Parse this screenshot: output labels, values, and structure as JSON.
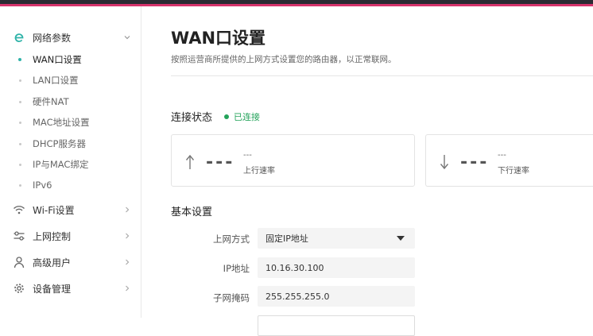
{
  "sidebar": {
    "groups": [
      {
        "label": "网络参数",
        "icon": "brand-e-icon"
      },
      {
        "label": "Wi-Fi设置",
        "icon": "wifi-icon"
      },
      {
        "label": "上网控制",
        "icon": "sliders-icon"
      },
      {
        "label": "高级用户",
        "icon": "user-icon"
      },
      {
        "label": "设备管理",
        "icon": "gear-icon"
      }
    ],
    "network_items": [
      {
        "label": "WAN口设置",
        "active": true
      },
      {
        "label": "LAN口设置"
      },
      {
        "label": "硬件NAT"
      },
      {
        "label": "MAC地址设置"
      },
      {
        "label": "DHCP服务器"
      },
      {
        "label": "IP与MAC绑定"
      },
      {
        "label": "IPv6"
      }
    ]
  },
  "page": {
    "title": "WAN口设置",
    "description": "按照运营商所提供的上网方式设置您的路由器，以正常联网。"
  },
  "status": {
    "heading": "连接状态",
    "state": "已连接",
    "state_color": "#23a35a",
    "upload": {
      "dash": "---",
      "value": "---",
      "label": "上行速率"
    },
    "download": {
      "dash": "---",
      "value": "---",
      "label": "下行速率"
    }
  },
  "basic": {
    "heading": "基本设置",
    "fields": [
      {
        "label": "上网方式",
        "value": "固定IP地址",
        "type": "select"
      },
      {
        "label": "IP地址",
        "value": "10.16.30.100"
      },
      {
        "label": "子网掩码",
        "value": "255.255.255.0"
      }
    ]
  },
  "colors": {
    "accent": "#2fb3a8",
    "topbar": "#2b2b33",
    "topbar_stripe": "#d6336c"
  }
}
